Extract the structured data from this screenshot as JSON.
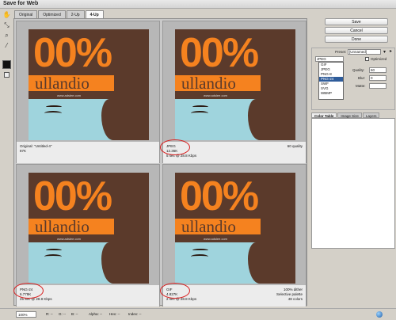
{
  "window": {
    "title": "Save for Web"
  },
  "tabs": [
    "Original",
    "Optimized",
    "2-Up",
    "4-Up"
  ],
  "panes": [
    {
      "pct": "00%",
      "brand": "ullandio",
      "url": "www.adslee.com",
      "info_left": [
        "Original: \"Untitled-4\"",
        "87K"
      ],
      "info_right": []
    },
    {
      "pct": "00%",
      "brand": "ullandio",
      "url": "www.adslee.com",
      "info_left": [
        "JPEG",
        "12.36K",
        "5 sec @ 28.8 Kbps"
      ],
      "info_right": [
        "60 quality"
      ]
    },
    {
      "pct": "00%",
      "brand": "ullandio",
      "url": "www.adslee.com",
      "info_left": [
        "PNG-24",
        "6.779K",
        "25 sec @ 28.8 Kbps"
      ],
      "info_right": []
    },
    {
      "pct": "00%",
      "brand": "ullandio",
      "url": "www.adslee.com",
      "info_left": [
        "GIF",
        "4.827K",
        "2 sec @ 28.8 Kbps"
      ],
      "info_right": [
        "100% dither",
        "Selective palette",
        "48 colors"
      ]
    }
  ],
  "buttons": {
    "save": "Save",
    "cancel": "Cancel",
    "done": "Done"
  },
  "settings": {
    "preset_label": "Preset:",
    "preset_value": "[Unnamed]",
    "format_value": "JPEG",
    "format_options": [
      "GIF",
      "JPEG",
      "PNG-8",
      "PNG-24",
      "SWF",
      "SVG",
      "WBMP"
    ],
    "format_selected_index": 3,
    "optimized_label": "Optimized",
    "quality_label": "Quality:",
    "quality_value": "60",
    "blur_label": "Blur:",
    "blur_value": "0",
    "matte_label": "Matte:"
  },
  "color_tabs": [
    "Color Table",
    "Image Size",
    "Layers"
  ],
  "status": {
    "zoom": "100%",
    "r": "R: --",
    "g": "G: --",
    "b": "B: --",
    "alpha": "Alpha: --",
    "hex": "Hex: --",
    "index": "Index: --"
  }
}
